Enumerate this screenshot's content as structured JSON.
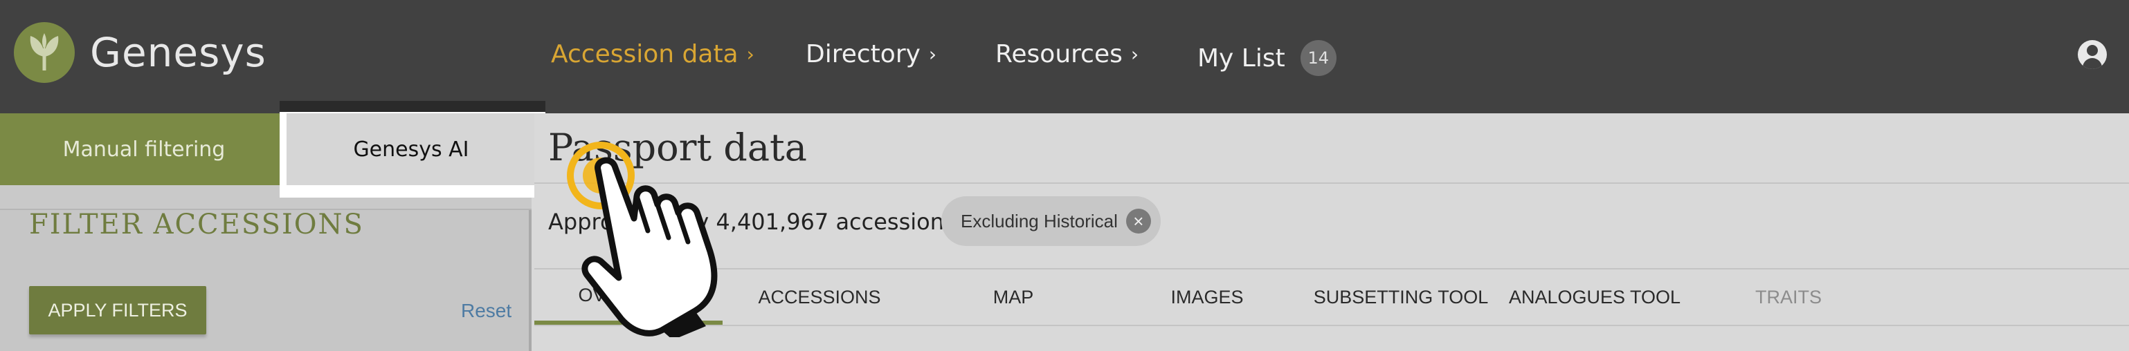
{
  "header": {
    "logo_text": "Genesys",
    "nav": [
      {
        "label": "Accession data",
        "chevron": "›"
      },
      {
        "label": "Directory",
        "chevron": "›"
      },
      {
        "label": "Resources",
        "chevron": "›"
      },
      {
        "label": "My List",
        "badge": "14"
      }
    ]
  },
  "sidebar": {
    "tabs": [
      "Manual filtering",
      "Genesys AI"
    ],
    "filter_title": "FILTER ACCESSIONS",
    "apply_label": "APPLY FILTERS",
    "reset_label": "Reset"
  },
  "main": {
    "title": "Passport data",
    "summary": "Approximately 4,401,967 accessions",
    "chip_label": "Excluding Historical",
    "chip_close": "×",
    "tabs": [
      "OVERVIEW",
      "ACCESSIONS",
      "MAP",
      "IMAGES",
      "SUBSETTING TOOL",
      "ANALOGUES TOOL",
      "TRAITS"
    ]
  },
  "colors": {
    "accent_olive": "#7b8a45",
    "accent_gold": "#d9a633",
    "topbar_bg": "#414141"
  },
  "icons": {
    "logo": "leaf-logo-icon",
    "user": "user-account-icon",
    "cursor": "hand-pointer-cursor-icon"
  }
}
